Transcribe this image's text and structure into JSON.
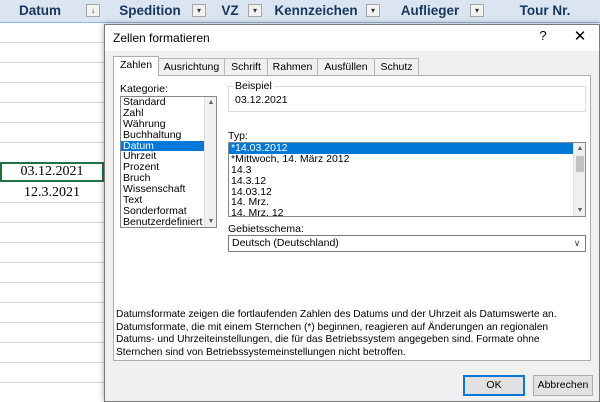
{
  "sheet": {
    "headers": [
      {
        "label": "Datum"
      },
      {
        "label": "Spedition"
      },
      {
        "label": "VZ"
      },
      {
        "label": "Kennzeichen"
      },
      {
        "label": "Auflieger"
      },
      {
        "label": "Tour Nr."
      }
    ],
    "cells": [
      "03.12.2021",
      "12.3.2021"
    ],
    "colors": {
      "header_bg": "#dbe5f1",
      "header_text": "#17375e",
      "active_border": "#217346"
    }
  },
  "dialog": {
    "title": "Zellen formatieren",
    "help_label": "?",
    "close_label": "✕",
    "tabs": [
      "Zahlen",
      "Ausrichtung",
      "Schrift",
      "Rahmen",
      "Ausfüllen",
      "Schutz"
    ],
    "active_tab": "Zahlen",
    "kategorie": {
      "label": "Kategorie:",
      "items": [
        "Standard",
        "Zahl",
        "Währung",
        "Buchhaltung",
        "Datum",
        "Uhrzeit",
        "Prozent",
        "Bruch",
        "Wissenschaft",
        "Text",
        "Sonderformat",
        "Benutzerdefiniert"
      ],
      "selected": "Datum"
    },
    "beispiel": {
      "label": "Beispiel",
      "value": "03.12.2021"
    },
    "typ": {
      "label": "Typ:",
      "items": [
        "*14.03.2012",
        "*Mittwoch, 14. März 2012",
        "14.3",
        "14.3.12",
        "14.03.12",
        "14. Mrz.",
        "14. Mrz. 12"
      ],
      "selected": "*14.03.2012"
    },
    "gebietsschema": {
      "label": "Gebietsschema:",
      "value": "Deutsch (Deutschland)"
    },
    "description": "Datumsformate zeigen die fortlaufenden Zahlen des Datums und der Uhrzeit als Datumswerte an. Datumsformate, die mit einem Sternchen (*) beginnen, reagieren auf Änderungen an regionalen Datums- und Uhrzeiteinstellungen, die für das Betriebssystem angegeben sind. Formate ohne Sternchen sind von Betriebssystemeinstellungen nicht betroffen.",
    "ok_label": "OK",
    "cancel_label": "Abbrechen",
    "colors": {
      "selection": "#0078d7",
      "dialog_bg": "#f0f0f0"
    }
  }
}
